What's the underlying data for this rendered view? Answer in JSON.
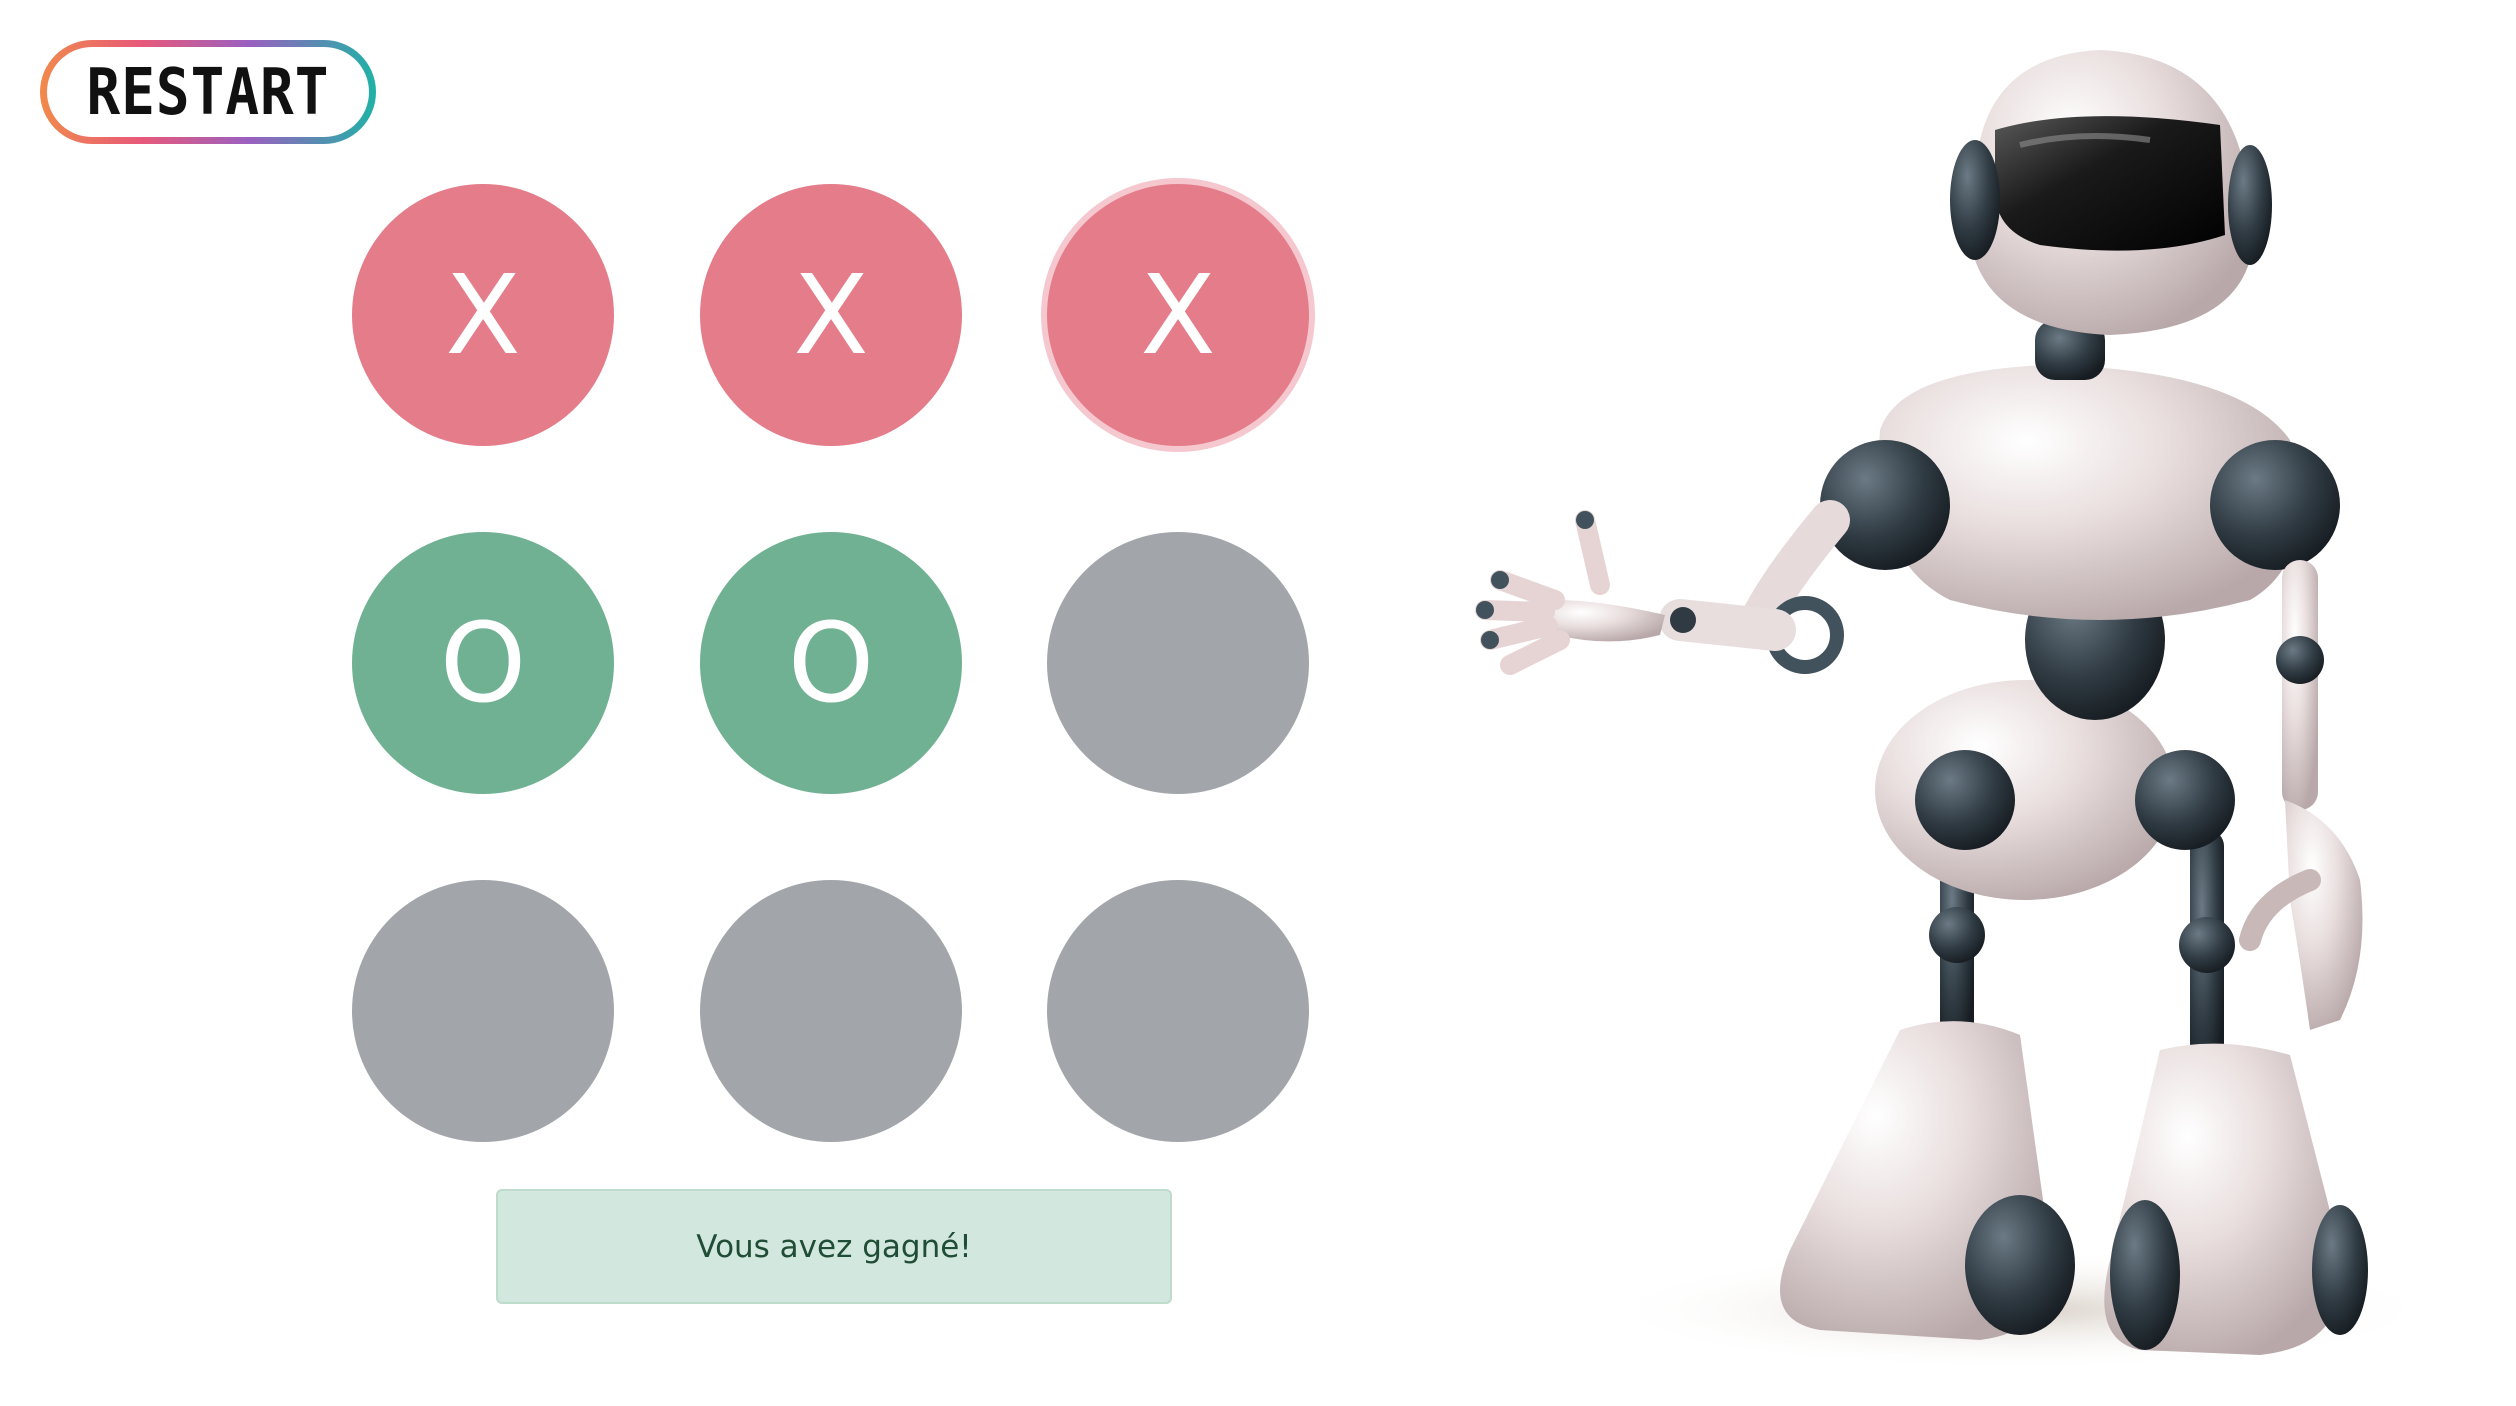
{
  "header": {
    "restart_label": "RESTART"
  },
  "board": {
    "cells": [
      "X",
      "X",
      "X",
      "O",
      "O",
      "",
      "",
      "",
      ""
    ]
  },
  "message": {
    "text": "Vous avez gagné!"
  },
  "colors": {
    "x_cell": "#e57c8a",
    "o_cell": "#70b193",
    "empty_cell": "#a2a6aa",
    "success_bg": "#d2e7de",
    "success_text": "#1f4d36"
  },
  "robot": {
    "icon": "robot-illustration"
  }
}
